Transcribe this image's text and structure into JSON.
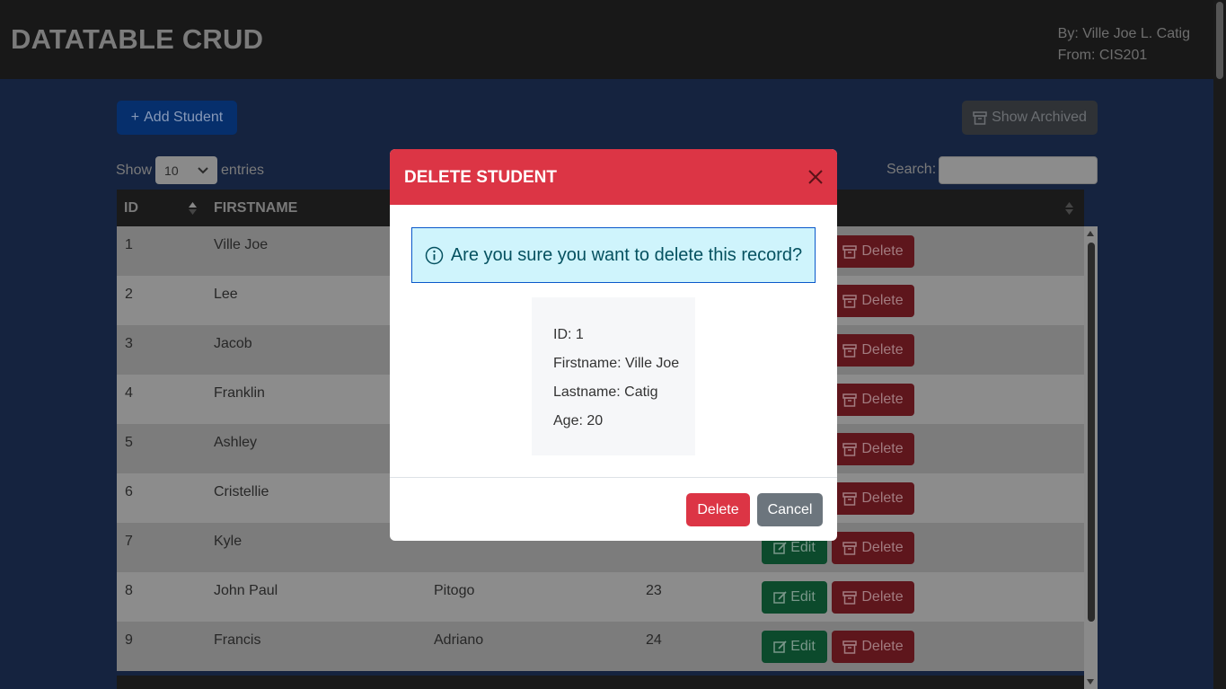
{
  "header": {
    "title": "DATATABLE CRUD",
    "author": "By: Ville Joe L. Catig",
    "from": "From: CIS201"
  },
  "toolbar": {
    "add_label": "Add Student",
    "archived_label": "Show Archived",
    "show_label": "Show",
    "entries_value": "10",
    "entries_label": "entries",
    "search_label": "Search:"
  },
  "table": {
    "columns": [
      "ID",
      "FIRSTNAME"
    ],
    "edit_label": "Edit",
    "delete_label": "Delete",
    "rows": [
      {
        "id": "1",
        "firstname": "Ville Joe",
        "lastname": "",
        "age": ""
      },
      {
        "id": "2",
        "firstname": "Lee",
        "lastname": "",
        "age": ""
      },
      {
        "id": "3",
        "firstname": "Jacob",
        "lastname": "",
        "age": ""
      },
      {
        "id": "4",
        "firstname": "Franklin",
        "lastname": "",
        "age": ""
      },
      {
        "id": "5",
        "firstname": "Ashley",
        "lastname": "",
        "age": ""
      },
      {
        "id": "6",
        "firstname": "Cristellie",
        "lastname": "",
        "age": ""
      },
      {
        "id": "7",
        "firstname": "Kyle",
        "lastname": "",
        "age": ""
      },
      {
        "id": "8",
        "firstname": "John Paul",
        "lastname": "Pitogo",
        "age": "23"
      },
      {
        "id": "9",
        "firstname": "Francis",
        "lastname": "Adriano",
        "age": "24"
      }
    ]
  },
  "modal": {
    "title": "DELETE STUDENT",
    "message": "Are you sure you want to delete this record?",
    "id": "ID: 1",
    "firstname": "Firstname: Ville Joe",
    "lastname": "Lastname: Catig",
    "age": "Age: 20",
    "confirm_label": "Delete",
    "cancel_label": "Cancel"
  },
  "colors": {
    "modal_header": "#dc3545",
    "alert_bg": "#cff4fc",
    "cancel": "#6c757d"
  }
}
